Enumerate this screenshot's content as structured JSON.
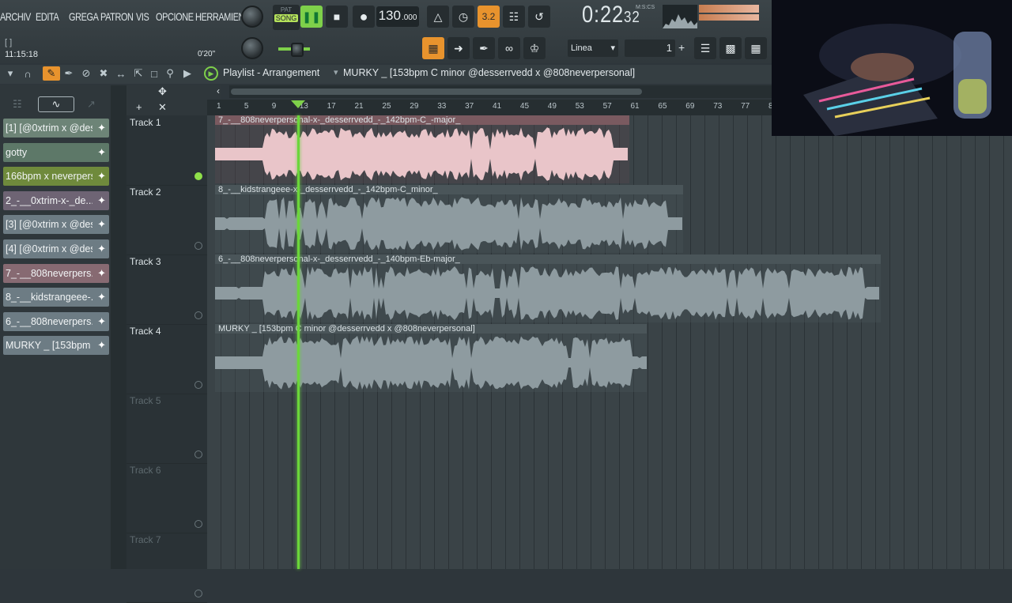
{
  "menu": [
    "ARCHIV",
    "EDITA",
    "GREGA",
    "PATRON",
    "VIS",
    "OPCIONE",
    "HERRAMIENTA"
  ],
  "transport": {
    "pat_label": "PAT",
    "song_label": "SONG",
    "tempo_int": "130",
    "tempo_dec": ".000",
    "time_main": "0:22",
    "time_sub": "32",
    "time_mode": "M:S:CS",
    "step_value": "3.2"
  },
  "hint": {
    "brackets": "[ ]",
    "clock": "11:15:18",
    "offset": "0'20\""
  },
  "snap": {
    "label": "Linea",
    "value": "1"
  },
  "playlist": {
    "title": "Playlist - Arrangement",
    "pattern": "MURKY _ [153bpm C minor @desserrvedd x @808neverpersonal]"
  },
  "browser_items": [
    {
      "label": "[1] [@0xtrim x @des...",
      "color": "#6d8477"
    },
    {
      "label": "gotty",
      "color": "#5d7868"
    },
    {
      "label": "166bpm x neverpers...",
      "color": "#6f8a3c"
    },
    {
      "label": "2_-__0xtrim-x-_de...",
      "color": "#6e6474"
    },
    {
      "label": "[3] [@0xtrim x @des...",
      "color": "#6d7c84"
    },
    {
      "label": "[4] [@0xtrim x @des...",
      "color": "#6d7c84"
    },
    {
      "label": "7_-__808neverpers...",
      "color": "#876a72"
    },
    {
      "label": "8_-__kidstrangeee-...",
      "color": "#6d7c84"
    },
    {
      "label": "6_-__808neverpers...",
      "color": "#6d7c84"
    },
    {
      "label": "MURKY _ [153bpm C...",
      "color": "#6d7c84"
    }
  ],
  "ruler_ticks": [
    "1",
    "5",
    "9",
    "13",
    "17",
    "21",
    "25",
    "29",
    "33",
    "37",
    "41",
    "45",
    "49",
    "53",
    "57",
    "61",
    "65",
    "69",
    "73",
    "77",
    "8"
  ],
  "tracks": [
    {
      "label": "Track 1"
    },
    {
      "label": "Track 2"
    },
    {
      "label": "Track 3"
    },
    {
      "label": "Track 4"
    },
    {
      "label": "Track 5"
    },
    {
      "label": "Track 6"
    },
    {
      "label": "Track 7"
    }
  ],
  "clips": [
    {
      "title": "7_-__808neverpersonal-x-_desserrvedd_-_142bpm-C_-major_",
      "color": "#e9c5c9",
      "head": "#7a5a60"
    },
    {
      "title": "8_-__kidstrangeee-x-_desserrvedd_-_142bpm-C_minor_",
      "color": "#8e9ba0",
      "head": "#4a5559"
    },
    {
      "title": "6_-__808neverpersonal-x-_desserrvedd_-_140bpm-Eb-major_",
      "color": "#8e9ba0",
      "head": "#4a5559"
    },
    {
      "title": "MURKY _ [153bpm C minor @desserrvedd x @808neverpersonal]",
      "color": "#8e9ba0",
      "head": "#4a5559"
    }
  ]
}
